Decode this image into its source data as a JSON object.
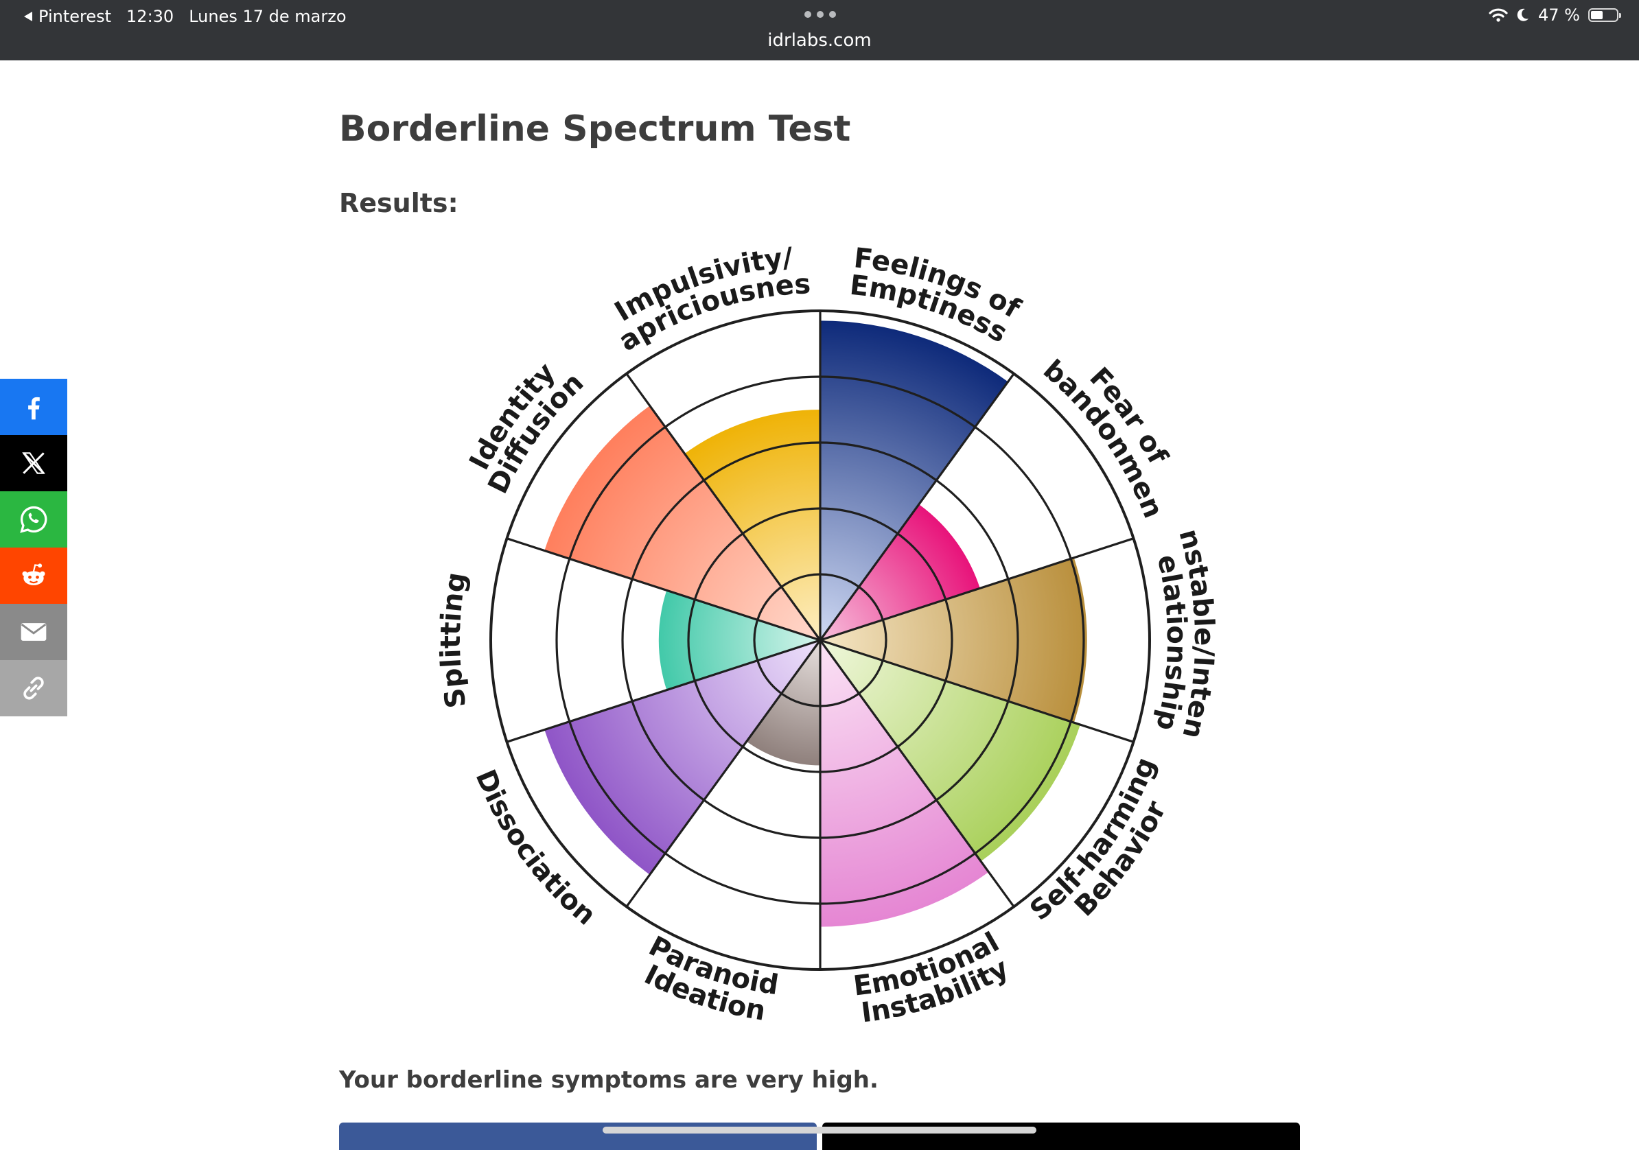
{
  "status_bar": {
    "back_app": "Pinterest",
    "time": "12:30",
    "date": "Lunes 17 de marzo",
    "url": "idrlabs.com",
    "battery": "47 %"
  },
  "page": {
    "title": "Borderline Spectrum Test",
    "results_label": "Results:",
    "summary": "Your borderline symptoms are very high."
  },
  "share_buttons": [
    {
      "name": "facebook",
      "color": "#1877f2",
      "icon": "facebook-icon"
    },
    {
      "name": "x",
      "color": "#000000",
      "icon": "x-icon"
    },
    {
      "name": "whatsapp",
      "color": "#2bb741",
      "icon": "whatsapp-icon"
    },
    {
      "name": "reddit",
      "color": "#ff4500",
      "icon": "reddit-icon"
    },
    {
      "name": "email",
      "color": "#8a8a8a",
      "icon": "mail-icon"
    },
    {
      "name": "copy-link",
      "color": "#a7a7a7",
      "icon": "link-icon"
    }
  ],
  "chart_data": {
    "type": "polar-area",
    "categories": [
      "Feelings of Emptiness",
      "Fear of Abandonment",
      "Unstable/Intense Relationships",
      "Self-harming Behavior",
      "Emotional Instability",
      "Paranoid Ideation",
      "Dissociation",
      "Splitting",
      "Identity Diffusion",
      "Impulsivity/ Capriciousness"
    ],
    "values": [
      97,
      51,
      81,
      83,
      87,
      38,
      88,
      49,
      88,
      70
    ],
    "max": 100,
    "rings": 5,
    "colors": [
      [
        "#cfd9f3",
        "#0e2a7a"
      ],
      [
        "#f7bfdc",
        "#e8137a"
      ],
      [
        "#f5e6c6",
        "#b98f3c"
      ],
      [
        "#f0f7dc",
        "#a9d05a"
      ],
      [
        "#fbe3f5",
        "#e586d3"
      ],
      [
        "#e7e0de",
        "#8f807c"
      ],
      [
        "#eee2fb",
        "#8f55c7"
      ],
      [
        "#d7f5ec",
        "#42c9a9"
      ],
      [
        "#ffd9cc",
        "#ff7f5d"
      ],
      [
        "#fdeec2",
        "#efb307"
      ]
    ]
  }
}
